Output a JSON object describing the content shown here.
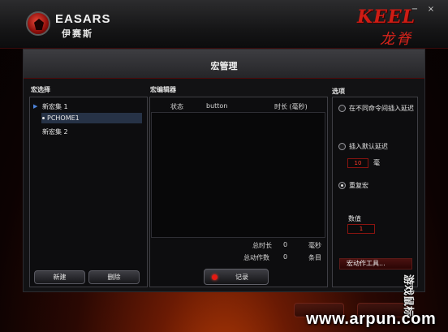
{
  "brand": {
    "name": "EASARS",
    "name_cn": "伊赛斯"
  },
  "model": {
    "name_en": "KEEL",
    "name_cn": "龙脊"
  },
  "window_controls": {
    "minimize": "−",
    "close": "×"
  },
  "dialog": {
    "title": "宏管理"
  },
  "macro_select": {
    "heading": "宏选择",
    "items": [
      {
        "label": "新宏集 1",
        "expanded": true
      },
      {
        "label": "PCHOME1",
        "selected": true
      },
      {
        "label": "新宏集 2"
      }
    ],
    "new_button": "新建",
    "delete_button": "删除"
  },
  "macro_editor": {
    "heading": "宏编辑器",
    "columns": [
      "状态",
      "button",
      "时长 (毫秒)"
    ],
    "total_duration_label": "总时长",
    "total_duration_value": "0",
    "total_duration_unit": "毫秒",
    "total_actions_label": "总动作数",
    "total_actions_value": "0",
    "total_actions_unit": "条目",
    "record_button": "记录"
  },
  "options": {
    "heading": "选项",
    "radio_between_commands": "在不同命令间插入延迟",
    "radio_default_delay": "插入默认延迟",
    "default_delay_value": "10",
    "default_delay_unit": "毫",
    "radio_repeat": "重复宏",
    "repeat_count_label": "数值",
    "repeat_count_value": "1",
    "selected_option": "重复宏",
    "tools_button": "宏动作工具..."
  },
  "side_text": "游戏鼠标",
  "watermark": "www.arpun.com",
  "colors": {
    "accent_red": "#d8231b",
    "panel_border": "#3e3e44",
    "selection": "#263246"
  }
}
